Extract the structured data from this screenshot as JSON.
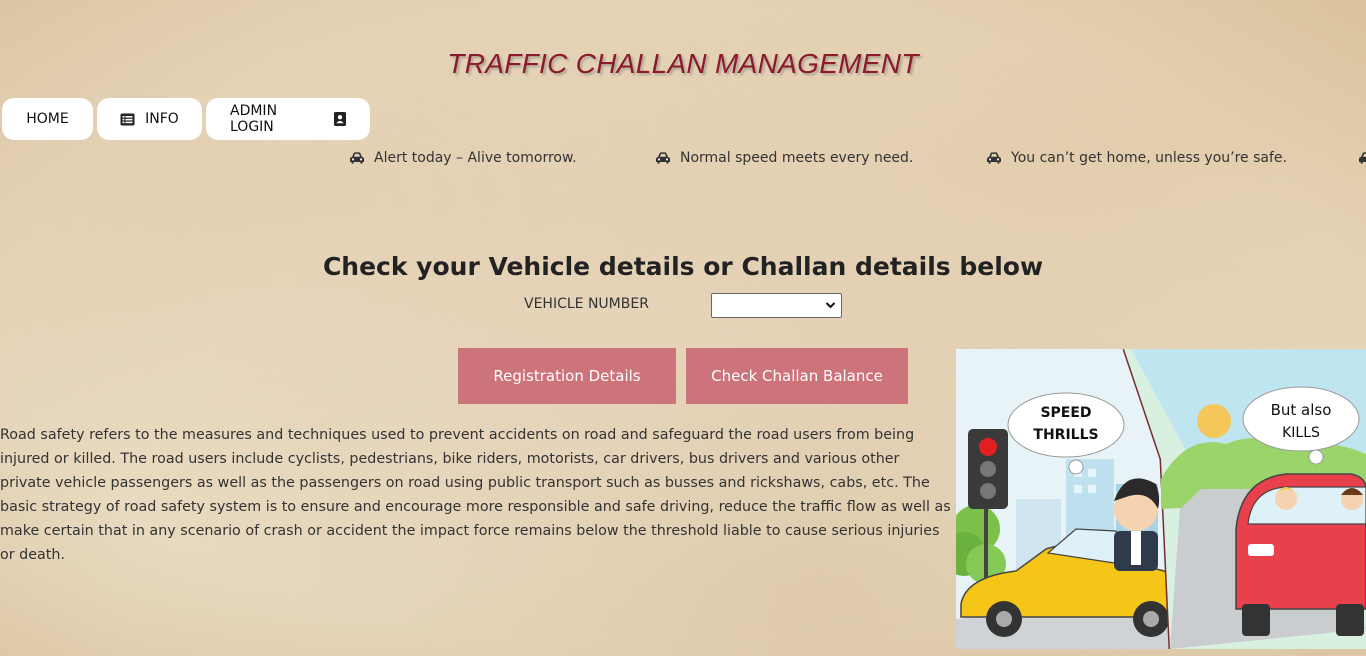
{
  "header": {
    "title": "TRAFFIC CHALLAN MANAGEMENT"
  },
  "nav": {
    "home": "HOME",
    "info": "INFO",
    "admin_login": "ADMIN LOGIN"
  },
  "ticker": [
    "Alert today – Alive tomorrow.",
    "Normal speed meets every need.",
    "You can’t get home, unless you’re safe."
  ],
  "form": {
    "heading": "Check your Vehicle details or Challan details below",
    "vehicle_label": "VEHICLE NUMBER",
    "vehicle_selected": ""
  },
  "buttons": {
    "registration": "Registration Details",
    "challan": "Check Challan Balance"
  },
  "paragraph": "Road safety refers to the measures and techniques used to prevent accidents on road and safeguard the road users from being injured or killed. The road users include cyclists, pedestrians, bike riders, motorists, car drivers, bus drivers and various other private vehicle passengers as well as the passengers on road using public transport such as busses and rickshaws, cabs, etc. The basic strategy of road safety system is to ensure and encourage more responsible and safe driving, reduce the traffic flow as well as make certain that in any scenario of crash or accident the impact force remains below the threshold liable to cause serious injuries or death.",
  "illustration": {
    "bubble_left_line1": "SPEED",
    "bubble_left_line2": "THRILLS",
    "bubble_right_line1": "But also",
    "bubble_right_line2": "KILLS"
  },
  "colors": {
    "title": "#8b1a2b",
    "button_bg": "#cd737b",
    "nav_bg": "#ffffff"
  },
  "icons": {
    "info": "list-icon",
    "admin": "contact-card-icon",
    "ticker": "car-icon"
  }
}
